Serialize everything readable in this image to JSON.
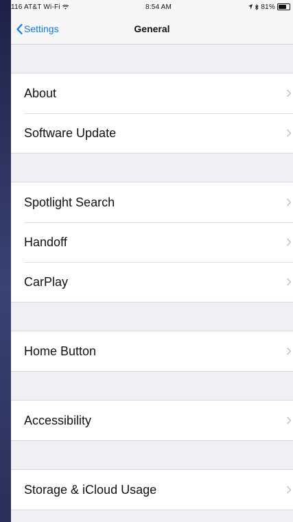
{
  "status_bar": {
    "carrier": "116 AT&T Wi-Fi",
    "time": "8:54 AM",
    "battery": "81%",
    "battery_level": 0.81
  },
  "nav": {
    "back_label": "Settings",
    "title": "General"
  },
  "groups": [
    {
      "items": [
        {
          "label": "About"
        },
        {
          "label": "Software Update"
        }
      ]
    },
    {
      "items": [
        {
          "label": "Spotlight Search"
        },
        {
          "label": "Handoff"
        },
        {
          "label": "CarPlay"
        }
      ]
    },
    {
      "items": [
        {
          "label": "Home Button"
        }
      ]
    },
    {
      "items": [
        {
          "label": "Accessibility"
        }
      ]
    },
    {
      "items": [
        {
          "label": "Storage & iCloud Usage"
        }
      ]
    }
  ],
  "colors": {
    "tint": "#0a7aff",
    "page_background": "#efeff4",
    "backdrop": "#2a2f57"
  }
}
